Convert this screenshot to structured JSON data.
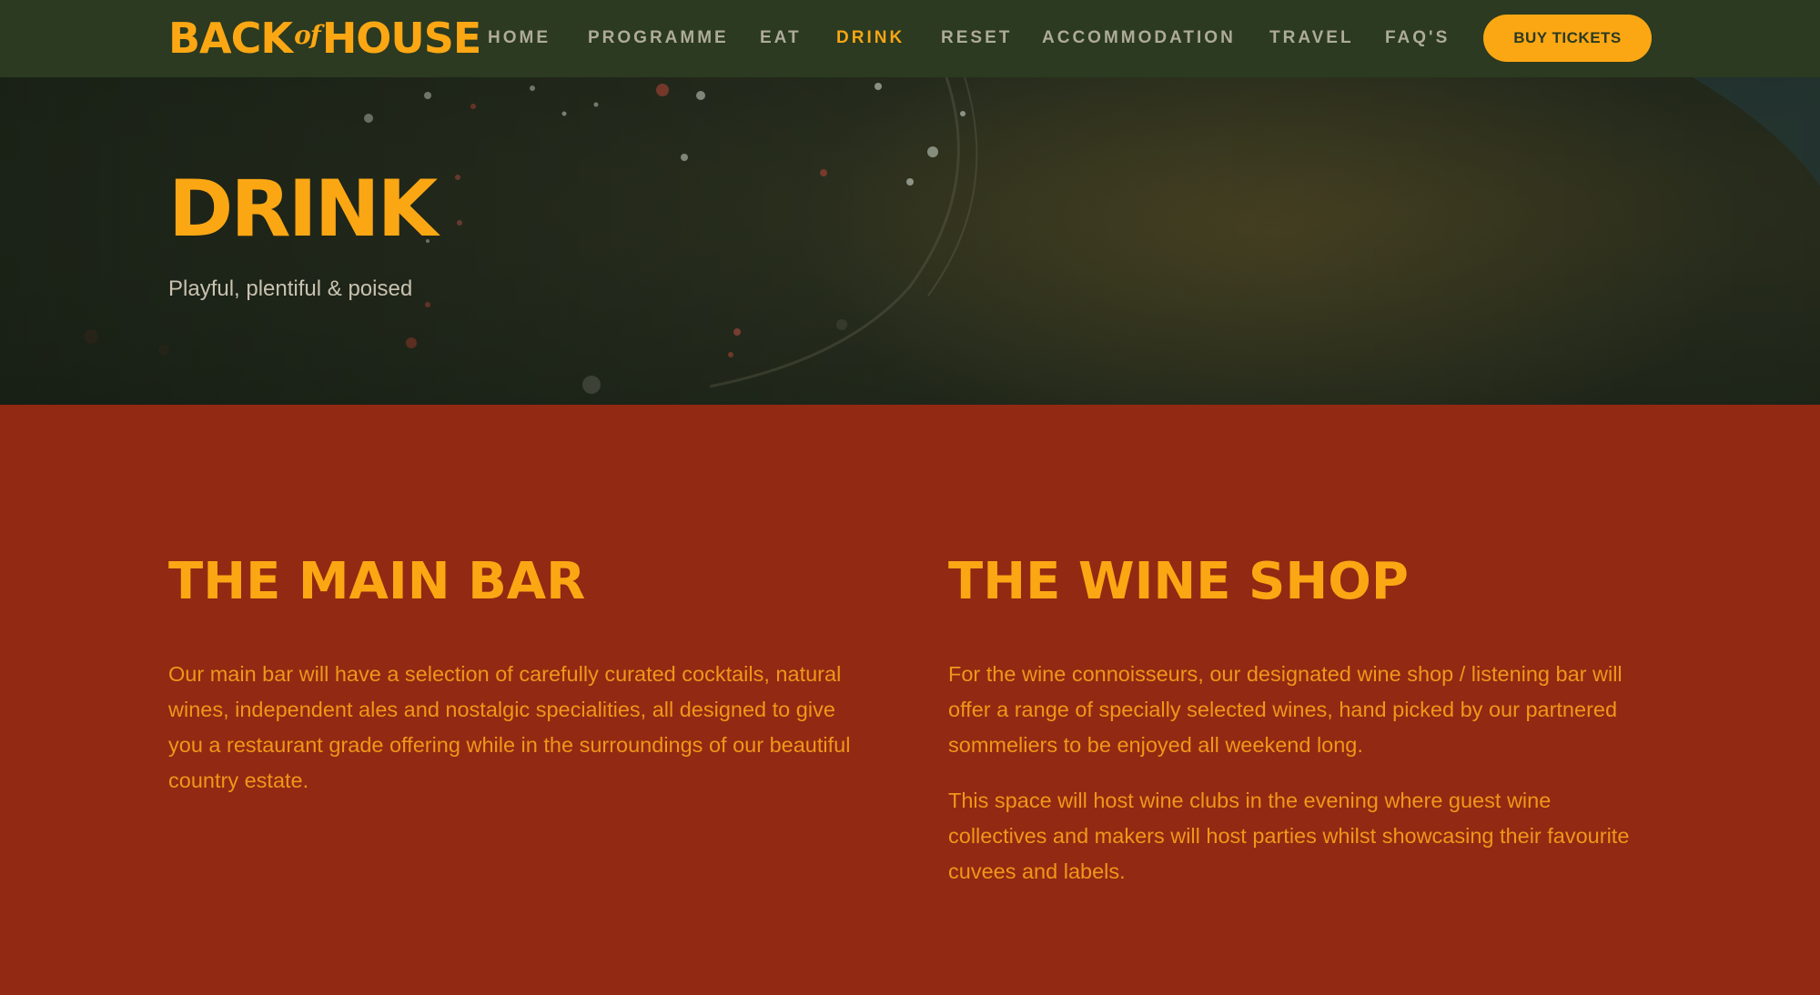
{
  "brand": {
    "logo_back": "BACK",
    "logo_of": "of",
    "logo_house": "HOUSE",
    "accent": "#fba714",
    "nav_bg": "#2b3a20",
    "content_bg": "#922912"
  },
  "nav": {
    "items": [
      {
        "label": "HOME",
        "active": false
      },
      {
        "label": "PROGRAMME",
        "active": false
      },
      {
        "label": "EAT",
        "active": false
      },
      {
        "label": "DRINK",
        "active": true
      },
      {
        "label": "RESET",
        "active": false
      },
      {
        "label": "ACCOMMODATION",
        "active": false
      },
      {
        "label": "TRAVEL",
        "active": false
      },
      {
        "label": "FAQ'S",
        "active": false
      }
    ],
    "cta_label": "BUY TICKETS"
  },
  "hero": {
    "title": "DRINK",
    "subtitle": "Playful, plentiful & poised"
  },
  "sections": {
    "main_bar": {
      "heading": "THE MAIN BAR",
      "paragraphs": [
        "Our main bar will have a selection of carefully curated cocktails, natural wines, independent ales and nostalgic specialities, all designed to give you a restaurant grade offering while in the surroundings of our beautiful country estate."
      ]
    },
    "wine_shop": {
      "heading": "THE WINE SHOP",
      "paragraphs": [
        "For the wine connoisseurs, our designated wine shop / listening bar will offer a range of specially selected wines, hand picked by our partnered sommeliers to be enjoyed all weekend long.",
        "This space will host wine clubs in the evening where guest wine collectives and makers will host parties whilst showcasing their favourite cuvees and labels."
      ]
    }
  }
}
